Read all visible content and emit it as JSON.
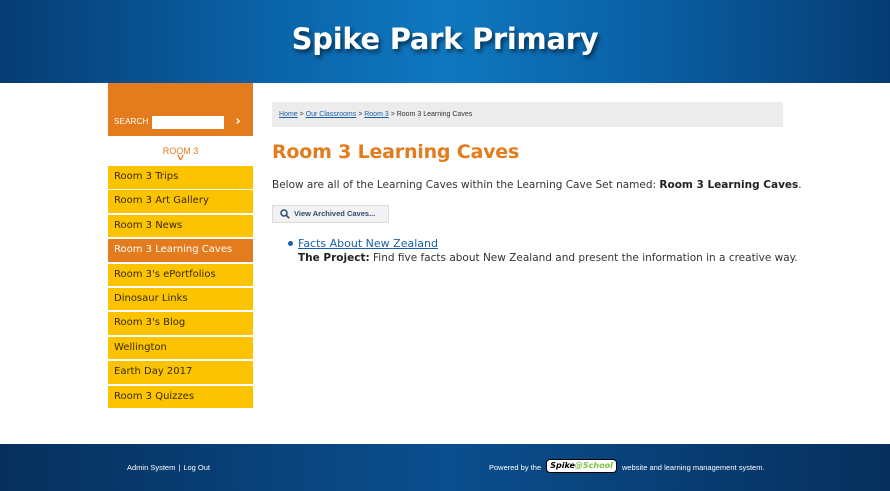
{
  "header": {
    "title": "Spike Park Primary"
  },
  "sidebar": {
    "search_label": "SEARCH",
    "search_value": "",
    "search_go_icon": "chevron-right-icon",
    "room_heading": "ROOM 3",
    "items": [
      {
        "label": "Room 3 Trips",
        "active": false
      },
      {
        "label": "Room 3 Art Gallery",
        "active": false
      },
      {
        "label": "Room 3 News",
        "active": false
      },
      {
        "label": "Room 3 Learning Caves",
        "active": true
      },
      {
        "label": "Room 3's ePortfolios",
        "active": false
      },
      {
        "label": "Dinosaur Links",
        "active": false
      },
      {
        "label": "Room 3's Blog",
        "active": false
      },
      {
        "label": "Wellington",
        "active": false
      },
      {
        "label": "Earth Day 2017",
        "active": false
      },
      {
        "label": "Room 3 Quizzes",
        "active": false
      }
    ]
  },
  "breadcrumb": {
    "home": "Home",
    "sep": " > ",
    "classrooms": "Our Classrooms",
    "room": "Room 3",
    "current": "Room 3 Learning Caves"
  },
  "main": {
    "title": "Room 3 Learning Caves",
    "intro_prefix": "Below are all of the Learning Caves within the Learning Cave Set named: ",
    "intro_set_name": "Room 3 Learning Caves",
    "intro_suffix": ".",
    "archive_button": "View Archived Caves...",
    "caves": [
      {
        "title": "Facts About New Zealand",
        "project_label": "The Project:",
        "project_text": " Find five facts about New Zealand and present the information in a creative way."
      }
    ]
  },
  "footer": {
    "admin_link": "Admin System",
    "separator": "|",
    "logout_link": "Log Out",
    "powered_prefix": "Powered by the",
    "logo_text_a": "Spike",
    "logo_text_b": "@School",
    "powered_suffix": "website and learning management system."
  },
  "colors": {
    "orange": "#e47b1c",
    "yellow": "#fcc400",
    "blue": "#0a63a8",
    "link": "#1a5fa8"
  }
}
